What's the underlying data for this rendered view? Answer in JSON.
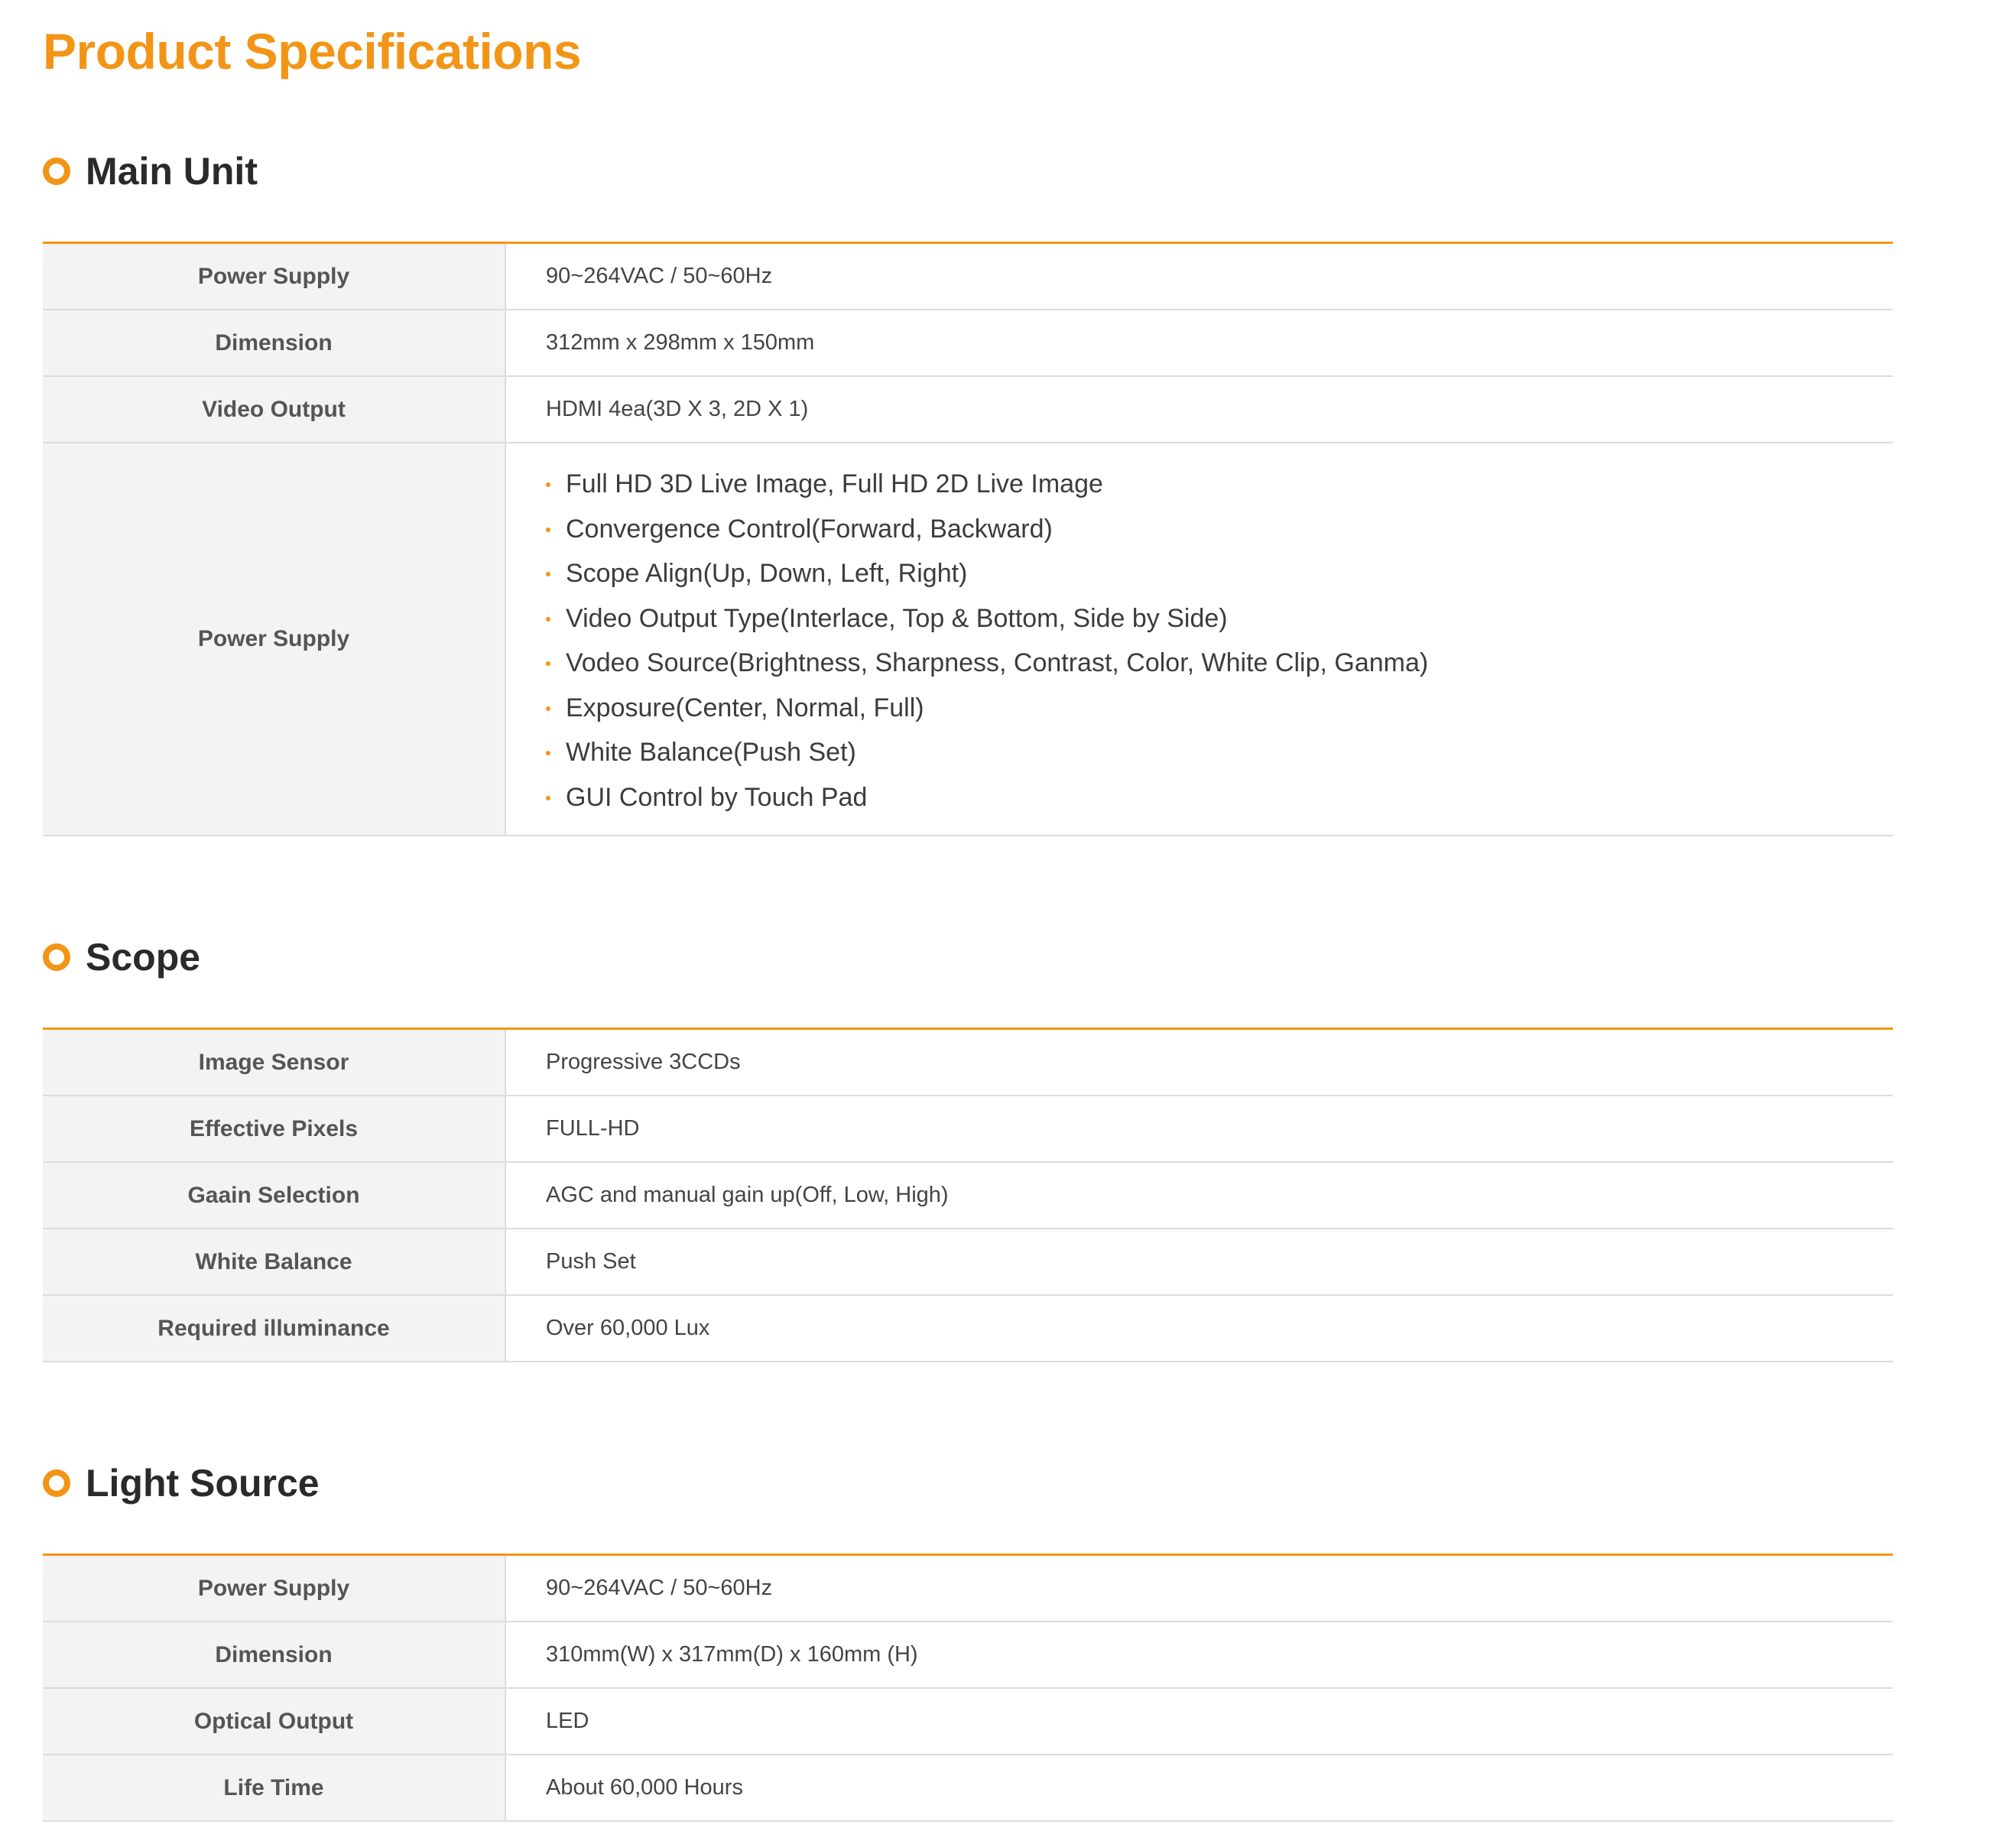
{
  "page": {
    "title": "Product Specifications"
  },
  "colors": {
    "accent": "#f29516",
    "label_bg": "#f3f3f3",
    "row_border": "#dcdcdc"
  },
  "sections": [
    {
      "title": "Main Unit",
      "rows": [
        {
          "label": "Power Supply",
          "value": "90~264VAC / 50~60Hz"
        },
        {
          "label": "Dimension",
          "value": "312mm x 298mm x 150mm"
        },
        {
          "label": "Video Output",
          "value": "HDMI 4ea(3D X 3, 2D X 1)"
        },
        {
          "label": "Power Supply",
          "items": [
            "Full HD 3D Live Image, Full HD 2D Live Image",
            "Convergence Control(Forward, Backward)",
            "Scope Align(Up, Down, Left, Right)",
            "Video Output Type(Interlace, Top & Bottom, Side by Side)",
            "Vodeo Source(Brightness, Sharpness, Contrast, Color, White Clip, Ganma)",
            "Exposure(Center, Normal, Full)",
            "White Balance(Push Set)",
            "GUI Control by Touch Pad"
          ]
        }
      ]
    },
    {
      "title": "Scope",
      "rows": [
        {
          "label": "Image Sensor",
          "value": "Progressive 3CCDs"
        },
        {
          "label": "Effective Pixels",
          "value": "FULL-HD"
        },
        {
          "label": "Gaain Selection",
          "value": "AGC and manual gain up(Off, Low, High)"
        },
        {
          "label": "White Balance",
          "value": "Push Set"
        },
        {
          "label": "Required illuminance",
          "value": "Over 60,000 Lux"
        }
      ]
    },
    {
      "title": "Light Source",
      "rows": [
        {
          "label": "Power Supply",
          "value": "90~264VAC / 50~60Hz"
        },
        {
          "label": "Dimension",
          "value": "310mm(W) x 317mm(D) x 160mm (H)"
        },
        {
          "label": "Optical Output",
          "value": "LED"
        },
        {
          "label": "Life Time",
          "value": "About 60,000 Hours"
        }
      ]
    }
  ]
}
